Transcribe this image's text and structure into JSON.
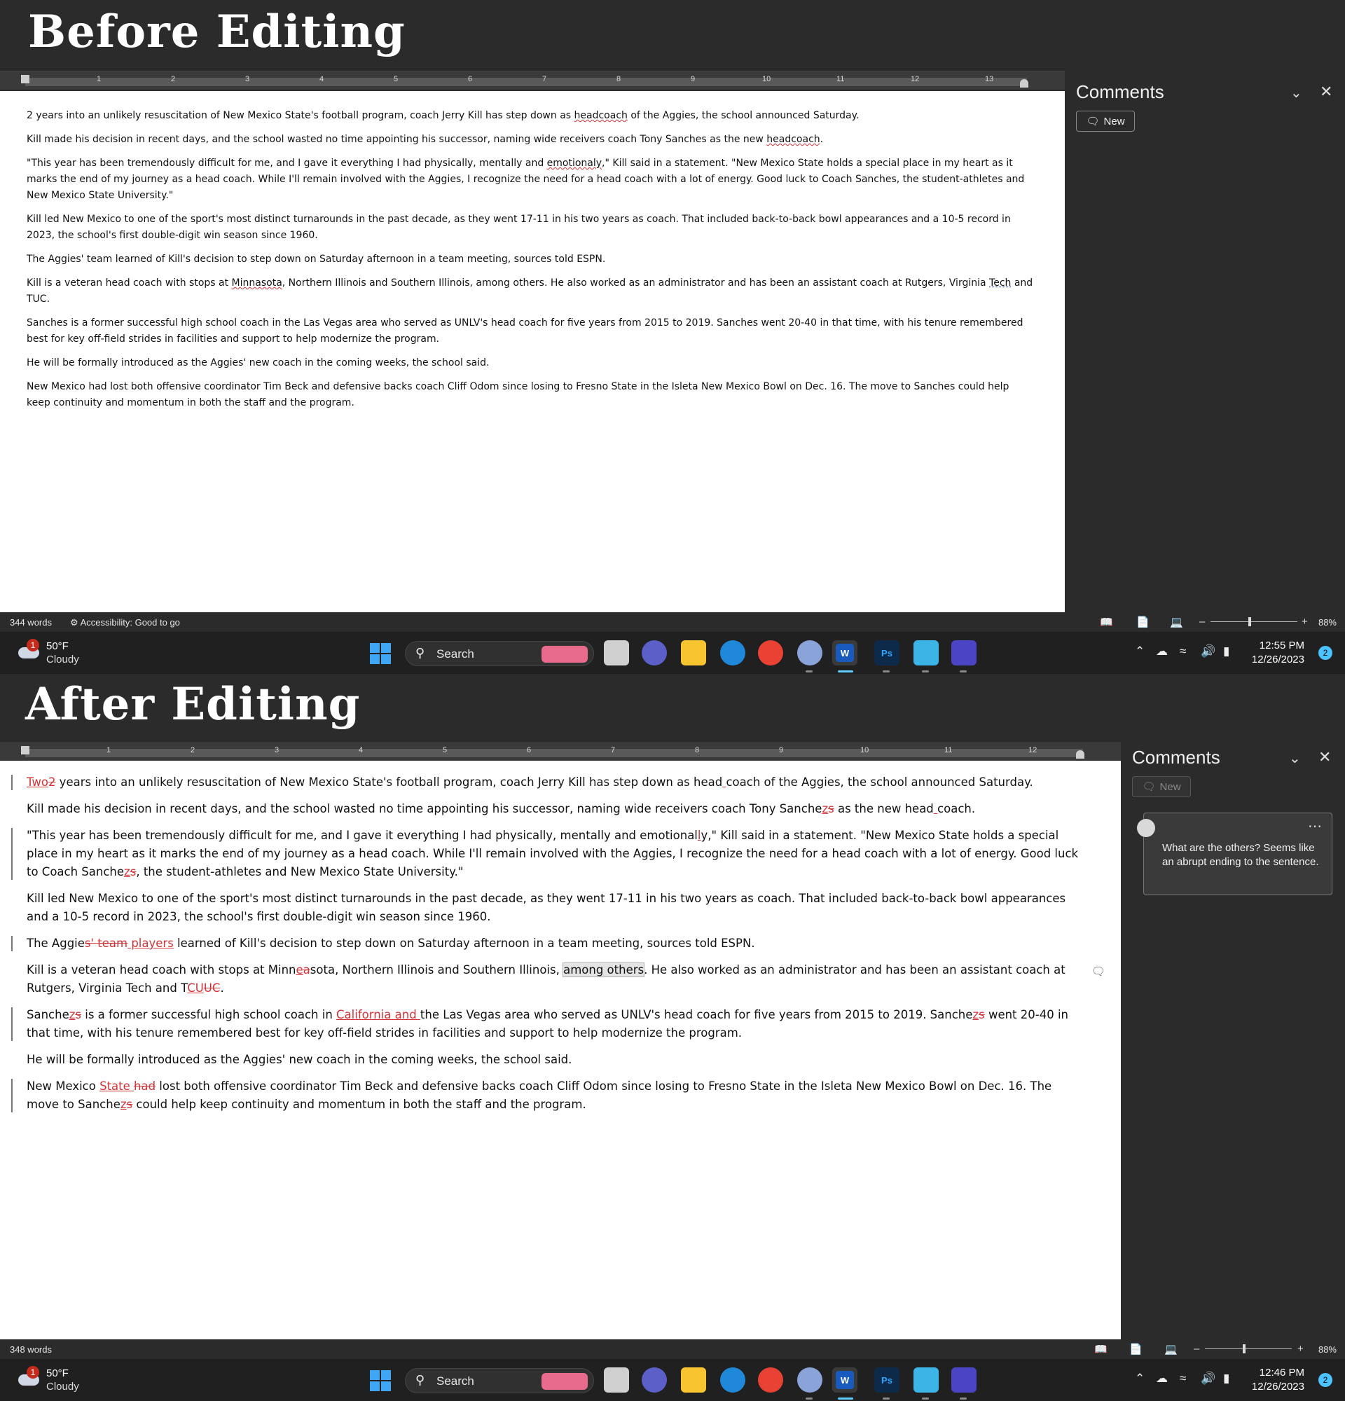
{
  "before": {
    "title": "Before Editing",
    "ruler_numbers": [
      "1",
      "2",
      "3",
      "4",
      "5",
      "6",
      "7",
      "8",
      "9",
      "10",
      "11",
      "12",
      "13"
    ],
    "paragraphs": {
      "p1": {
        "a": "2 years into an unlikely resuscitation of New Mexico State's football program, coach Jerry Kill has step down as ",
        "b": "headcoach",
        "c": " of the Aggies, the school announced Saturday."
      },
      "p2": {
        "a": "Kill made his decision in recent days, and the school wasted no time appointing his successor, naming wide receivers coach Tony Sanches as the new ",
        "b": "headcoach",
        "c": "."
      },
      "p3": {
        "a": "\"This year has been tremendously difficult for me, and I gave it everything I had physically, mentally and ",
        "b": "emotionaly",
        "c": ",\" Kill said in a statement. \"New Mexico State holds a special place in my heart as it marks the end of my journey as a head coach. While I'll remain involved with the Aggies, I recognize the need for a head coach with a lot of energy. Good luck to Coach Sanches, the student-athletes and New Mexico State University.\""
      },
      "p4": "Kill led New Mexico to one of the sport's most distinct turnarounds in the past decade, as they went 17-11 in his two years as coach. That included back-to-back bowl appearances and a 10-5 record in 2023, the school's first double-digit win season since 1960.",
      "p5": "The Aggies' team learned of Kill's decision to step down on Saturday afternoon in a team meeting, sources told ESPN.",
      "p6": {
        "a": "Kill is a veteran head coach with stops at ",
        "b": "Minnasota",
        "c": ", Northern Illinois and Southern Illinois, among others. He also worked as an administrator and has been an assistant coach at Rutgers, Virginia ",
        "d": "Tech",
        "e": " and TUC."
      },
      "p7": "Sanches is a former successful high school coach in the Las Vegas area who served as UNLV's head coach for five years from 2015 to 2019. Sanches went 20-40 in that time, with his tenure remembered best for key off-field strides in facilities and support to help modernize the program.",
      "p8": "He will be formally introduced as the Aggies' new coach in the coming weeks, the school said.",
      "p9": "New Mexico had lost both offensive coordinator Tim Beck and defensive backs coach Cliff Odom since losing to Fresno State in the Isleta New Mexico Bowl on Dec. 16. The move to Sanches could help keep continuity and momentum in both the staff and the program."
    },
    "comments": {
      "title": "Comments",
      "new_label": "New"
    },
    "status": {
      "words": "344 words",
      "accessibility": "Accessibility: Good to go",
      "zoom": "88%"
    },
    "taskbar": {
      "temp": "50°F",
      "condition": "Cloudy",
      "weather_badge": "1",
      "search": "Search",
      "time": "12:55 PM",
      "date": "12/26/2023",
      "notifications": "2"
    }
  },
  "after": {
    "title": "After Editing",
    "ruler_numbers": [
      "1",
      "2",
      "3",
      "4",
      "5",
      "6",
      "7",
      "8",
      "9",
      "10",
      "11",
      "12"
    ],
    "paragraphs": {
      "p1": {
        "ins1": "Two",
        "del1": "2",
        "a": " years into an unlikely resuscitation of New Mexico State's football program, coach Jerry Kill has step down as head",
        "ins2": " ",
        "b": "coach of the Aggies, the school announced Saturday."
      },
      "p2": {
        "a": "Kill made his decision in recent days, and the school wasted no time appointing his successor, naming wide receivers coach Tony Sanche",
        "ins1": "z",
        "del1": "s",
        "b": " as the new head",
        "ins2": " ",
        "c": "coach."
      },
      "p3": {
        "a": "\"This year has been tremendously difficult for me, and I gave it everything I had physically, mentally and emotional",
        "ins1": "l",
        "b": "y,\" Kill said in a statement. \"New Mexico State holds a special place in my heart as it marks the end of my journey as a head coach. While I'll remain involved with the Aggies, I recognize the need for a head coach with a lot of energy. Good luck to Coach Sanche",
        "ins2": "z",
        "del2": "s",
        "c": ", the student-athletes and New Mexico State University.\""
      },
      "p4": "Kill led New Mexico to one of the sport's most distinct turnarounds in the past decade, as they went 17-11 in his two years as coach. That included back-to-back bowl appearances and a 10-5 record in 2023, the school's first double-digit win season since 1960.",
      "p5": {
        "a": "The Aggie",
        "del1": "s' team",
        "ins1": " players",
        "b": " learned of Kill's decision to step down on Saturday afternoon in a team meeting, sources told ESPN."
      },
      "p6": {
        "a": "Kill is a veteran head coach with stops at Minn",
        "ins1": "e",
        "del1": "a",
        "b": "sota, Northern Illinois and Southern Illinois, ",
        "hl": "among others",
        "c": ". He also worked as an administrator and has been an assistant coach at Rutgers, Virginia Tech and T",
        "ins2": "CU",
        "del2": "UC",
        "d": "."
      },
      "p7": {
        "a": "Sanche",
        "ins1": "z",
        "del1": "s",
        "b": " is a former successful high school coach in ",
        "ins2": "California and ",
        "c": "the Las Vegas area who served as UNLV's head coach for five years from 2015 to 2019. Sanche",
        "ins3": "z",
        "del3": "s",
        "d": " went 20-40 in that time, with his tenure remembered best for key off-field strides in facilities and support to help modernize the program."
      },
      "p8": "He will be formally introduced as the Aggies' new coach in the coming weeks, the school said.",
      "p9": {
        "a": "New Mexico ",
        "ins1": "State ",
        "del1": "had",
        "b": " lost both offensive coordinator Tim Beck and defensive backs coach Cliff Odom since losing to Fresno State in the Isleta New Mexico Bowl on Dec. 16. The move to Sanche",
        "ins2": "z",
        "del2": "s",
        "c": " could help keep continuity and momentum in both the staff and the program."
      }
    },
    "comments": {
      "title": "Comments",
      "new_label": "New",
      "comment_text": "What are the others? Seems like an abrupt ending to the sentence."
    },
    "status": {
      "words": "348 words",
      "zoom": "88%"
    },
    "taskbar": {
      "temp": "50°F",
      "condition": "Cloudy",
      "weather_badge": "1",
      "search": "Search",
      "time": "12:46 PM",
      "date": "12/26/2023",
      "notifications": "2"
    }
  },
  "colors": {
    "revision_red": "#d13438",
    "accent_blue": "#3ea6f5",
    "word_blue": "#185abd"
  }
}
